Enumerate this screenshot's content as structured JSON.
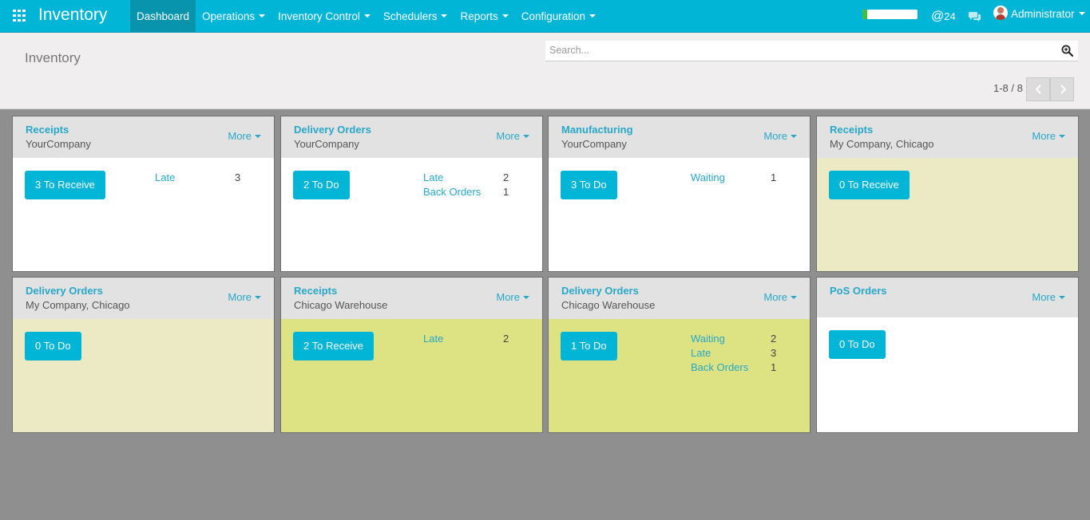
{
  "app": {
    "title": "Inventory"
  },
  "menu": [
    {
      "label": "Dashboard",
      "active": true,
      "dropdown": false
    },
    {
      "label": "Operations",
      "active": false,
      "dropdown": true
    },
    {
      "label": "Inventory Control",
      "active": false,
      "dropdown": true
    },
    {
      "label": "Schedulers",
      "active": false,
      "dropdown": true
    },
    {
      "label": "Reports",
      "active": false,
      "dropdown": true
    },
    {
      "label": "Configuration",
      "active": false,
      "dropdown": true
    }
  ],
  "systray": {
    "progress_fraction": 0.08,
    "mentions_count": "24",
    "user_name": "Administrator"
  },
  "breadcrumb": "Inventory",
  "search": {
    "placeholder": "Search..."
  },
  "pager": {
    "value": "1-8 / 8"
  },
  "colors": {
    "brand": "#00b5d6",
    "brand_dark": "#0794ac",
    "link": "#27a8c8",
    "beige": "#ece9c5",
    "olive": "#dde283",
    "white": "#ffffff"
  },
  "cards": [
    {
      "title": "Receipts",
      "subtitle": "YourCompany",
      "more": "More",
      "button": "3 To Receive",
      "bg": "white",
      "head_h": 52,
      "stats": [
        {
          "label": "Late",
          "value": "3"
        }
      ]
    },
    {
      "title": "Delivery Orders",
      "subtitle": "YourCompany",
      "more": "More",
      "button": "2 To Do",
      "bg": "white",
      "head_h": 52,
      "stats": [
        {
          "label": "Late",
          "value": "2"
        },
        {
          "label": "Back Orders",
          "value": "1"
        }
      ]
    },
    {
      "title": "Manufacturing",
      "subtitle": "YourCompany",
      "more": "More",
      "button": "3 To Do",
      "bg": "white",
      "head_h": 52,
      "stats": [
        {
          "label": "Waiting",
          "value": "1"
        }
      ]
    },
    {
      "title": "Receipts",
      "subtitle": "My Company, Chicago",
      "more": "More",
      "button": "0 To Receive",
      "bg": "beige",
      "head_h": 52,
      "stats": []
    },
    {
      "title": "Delivery Orders",
      "subtitle": "My Company, Chicago",
      "more": "More",
      "button": "0 To Do",
      "bg": "beige",
      "head_h": 52,
      "stats": []
    },
    {
      "title": "Receipts",
      "subtitle": "Chicago Warehouse",
      "more": "More",
      "button": "2 To Receive",
      "bg": "olive",
      "head_h": 52,
      "stats": [
        {
          "label": "Late",
          "value": "2"
        }
      ]
    },
    {
      "title": "Delivery Orders",
      "subtitle": "Chicago Warehouse",
      "more": "More",
      "button": "1 To Do",
      "bg": "olive",
      "head_h": 52,
      "stats": [
        {
          "label": "Waiting",
          "value": "2"
        },
        {
          "label": "Late",
          "value": "3"
        },
        {
          "label": "Back Orders",
          "value": "1"
        }
      ]
    },
    {
      "title": "PoS Orders",
      "subtitle": "",
      "more": "More",
      "button": "0 To Do",
      "bg": "white",
      "head_h": 50,
      "stats": []
    }
  ]
}
